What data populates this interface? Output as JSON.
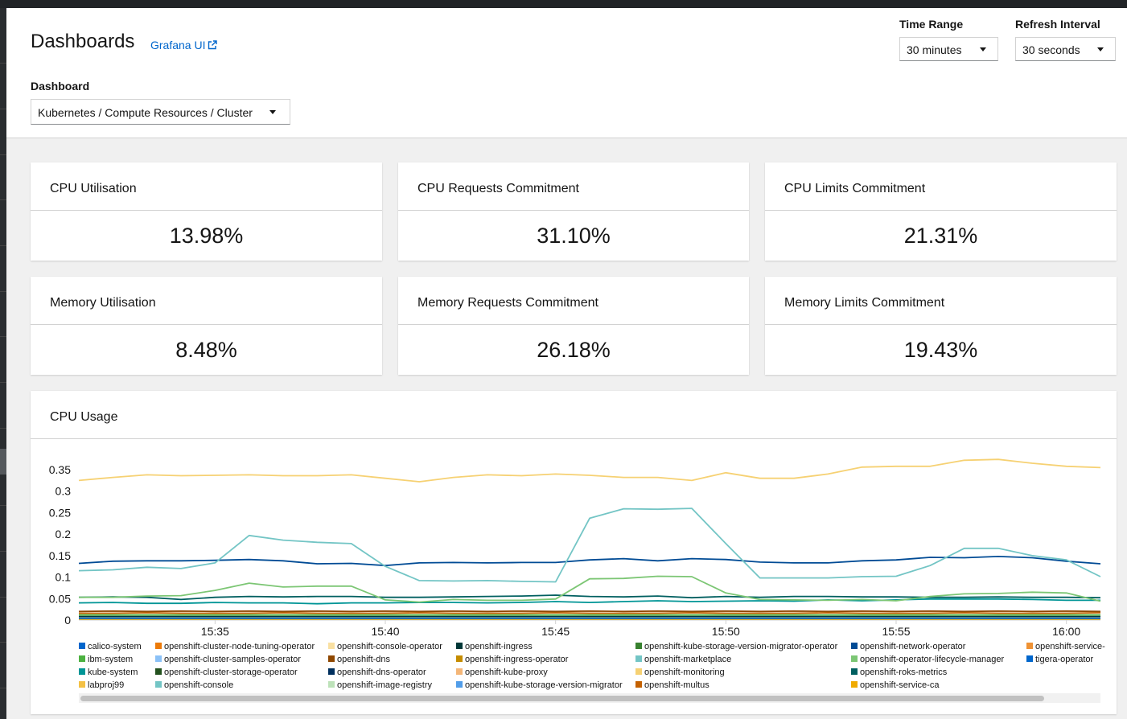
{
  "header": {
    "title": "Dashboards",
    "grafana_link": "Grafana UI",
    "time_range": {
      "label": "Time Range",
      "value": "30 minutes"
    },
    "refresh_interval": {
      "label": "Refresh Interval",
      "value": "30 seconds"
    },
    "dashboard": {
      "label": "Dashboard",
      "value": "Kubernetes / Compute Resources / Cluster"
    }
  },
  "stats": [
    {
      "title": "CPU Utilisation",
      "value": "13.98%"
    },
    {
      "title": "CPU Requests Commitment",
      "value": "31.10%"
    },
    {
      "title": "CPU Limits Commitment",
      "value": "21.31%"
    },
    {
      "title": "Memory Utilisation",
      "value": "8.48%"
    },
    {
      "title": "Memory Requests Commitment",
      "value": "26.18%"
    },
    {
      "title": "Memory Limits Commitment",
      "value": "19.43%"
    }
  ],
  "cpu_panel": {
    "title": "CPU Usage"
  },
  "legend": [
    {
      "name": "calico-system",
      "color": "#0066cc"
    },
    {
      "name": "ibm-system",
      "color": "#4cb140"
    },
    {
      "name": "kube-system",
      "color": "#009596"
    },
    {
      "name": "labproj99",
      "color": "#f4c145"
    },
    {
      "name": "openshift-cluster-node-tuning-operator",
      "color": "#ec7a08"
    },
    {
      "name": "openshift-cluster-samples-operator",
      "color": "#8bc1f7"
    },
    {
      "name": "openshift-cluster-storage-operator",
      "color": "#23511e"
    },
    {
      "name": "openshift-console",
      "color": "#73c5c5"
    },
    {
      "name": "openshift-console-operator",
      "color": "#f9e0a2"
    },
    {
      "name": "openshift-dns",
      "color": "#8f4700"
    },
    {
      "name": "openshift-dns-operator",
      "color": "#002f5d"
    },
    {
      "name": "openshift-image-registry",
      "color": "#bde2b9"
    },
    {
      "name": "openshift-ingress",
      "color": "#003737"
    },
    {
      "name": "openshift-ingress-operator",
      "color": "#c58c00"
    },
    {
      "name": "openshift-kube-proxy",
      "color": "#f4b678"
    },
    {
      "name": "openshift-kube-storage-version-migrator",
      "color": "#519de9"
    },
    {
      "name": "openshift-kube-storage-version-migrator-operator",
      "color": "#38812f"
    },
    {
      "name": "openshift-marketplace",
      "color": "#73c5c5"
    },
    {
      "name": "openshift-monitoring",
      "color": "#f6d173"
    },
    {
      "name": "openshift-multus",
      "color": "#c46100"
    },
    {
      "name": "openshift-network-operator",
      "color": "#004b95"
    },
    {
      "name": "openshift-operator-lifecycle-manager",
      "color": "#7cc674"
    },
    {
      "name": "openshift-roks-metrics",
      "color": "#005f60"
    },
    {
      "name": "openshift-service-ca",
      "color": "#f0ab00"
    },
    {
      "name": "openshift-service-",
      "color": "#ef9234"
    },
    {
      "name": "tigera-operator",
      "color": "#0066cc"
    }
  ],
  "chart_data": {
    "type": "line",
    "title": "CPU Usage",
    "xlabel": "",
    "ylabel": "",
    "ylim": [
      0,
      0.38
    ],
    "yticks": [
      0,
      0.05,
      0.1,
      0.15,
      0.2,
      0.25,
      0.3,
      0.35
    ],
    "ytick_labels": [
      "0",
      "0.05",
      "0.1",
      "0.15",
      "0.2",
      "0.25",
      "0.3",
      "0.35"
    ],
    "xlim": [
      "15:31",
      "16:01"
    ],
    "xtick_labels": [
      "15:35",
      "15:40",
      "15:45",
      "15:50",
      "15:55",
      "16:00"
    ],
    "grid": false,
    "legend_position": "bottom",
    "x": [
      "15:31",
      "15:32",
      "15:33",
      "15:34",
      "15:35",
      "15:36",
      "15:37",
      "15:38",
      "15:39",
      "15:40",
      "15:41",
      "15:42",
      "15:43",
      "15:44",
      "15:45",
      "15:46",
      "15:47",
      "15:48",
      "15:49",
      "15:50",
      "15:51",
      "15:52",
      "15:53",
      "15:54",
      "15:55",
      "15:56",
      "15:57",
      "15:58",
      "15:59",
      "16:00",
      "16:01"
    ],
    "series": [
      {
        "name": "openshift-monitoring",
        "color": "#f6d173",
        "values": [
          0.325,
          0.332,
          0.338,
          0.336,
          0.337,
          0.338,
          0.336,
          0.336,
          0.338,
          0.33,
          0.322,
          0.332,
          0.338,
          0.336,
          0.34,
          0.337,
          0.332,
          0.332,
          0.325,
          0.343,
          0.33,
          0.33,
          0.34,
          0.356,
          0.358,
          0.358,
          0.372,
          0.374,
          0.365,
          0.358,
          0.355
        ]
      },
      {
        "name": "openshift-marketplace",
        "color": "#73c5c5",
        "values": [
          0.115,
          0.117,
          0.123,
          0.12,
          0.133,
          0.197,
          0.186,
          0.181,
          0.178,
          0.125,
          0.092,
          0.091,
          0.092,
          0.09,
          0.089,
          0.237,
          0.259,
          0.258,
          0.26,
          0.178,
          0.098,
          0.098,
          0.098,
          0.101,
          0.102,
          0.127,
          0.167,
          0.167,
          0.15,
          0.14,
          0.101
        ]
      },
      {
        "name": "openshift-network-operator",
        "color": "#004b95",
        "values": [
          0.132,
          0.137,
          0.138,
          0.138,
          0.139,
          0.141,
          0.138,
          0.131,
          0.132,
          0.127,
          0.133,
          0.134,
          0.133,
          0.134,
          0.134,
          0.14,
          0.143,
          0.138,
          0.143,
          0.141,
          0.135,
          0.133,
          0.133,
          0.138,
          0.14,
          0.146,
          0.145,
          0.148,
          0.145,
          0.137,
          0.131
        ]
      },
      {
        "name": "openshift-operator-lifecycle-manager",
        "color": "#7cc674",
        "values": [
          0.053,
          0.053,
          0.056,
          0.057,
          0.069,
          0.086,
          0.077,
          0.079,
          0.079,
          0.047,
          0.042,
          0.048,
          0.046,
          0.046,
          0.049,
          0.096,
          0.097,
          0.102,
          0.101,
          0.063,
          0.048,
          0.047,
          0.046,
          0.048,
          0.045,
          0.055,
          0.061,
          0.062,
          0.065,
          0.063,
          0.044
        ]
      },
      {
        "name": "openshift-roks-metrics",
        "color": "#005f60",
        "values": [
          0.053,
          0.054,
          0.053,
          0.048,
          0.053,
          0.055,
          0.054,
          0.055,
          0.055,
          0.053,
          0.053,
          0.054,
          0.055,
          0.056,
          0.058,
          0.055,
          0.054,
          0.056,
          0.052,
          0.055,
          0.053,
          0.055,
          0.055,
          0.054,
          0.054,
          0.053,
          0.053,
          0.054,
          0.053,
          0.053,
          0.052
        ]
      },
      {
        "name": "kube-system",
        "color": "#009596",
        "values": [
          0.04,
          0.041,
          0.039,
          0.039,
          0.041,
          0.04,
          0.04,
          0.038,
          0.04,
          0.04,
          0.041,
          0.041,
          0.04,
          0.041,
          0.043,
          0.041,
          0.043,
          0.045,
          0.043,
          0.044,
          0.045,
          0.044,
          0.047,
          0.045,
          0.047,
          0.049,
          0.049,
          0.049,
          0.048,
          0.046,
          0.046
        ]
      },
      {
        "name": "openshift-dns",
        "color": "#8f4700",
        "values": [
          0.02,
          0.021,
          0.02,
          0.021,
          0.02,
          0.021,
          0.02,
          0.021,
          0.02,
          0.021,
          0.02,
          0.021,
          0.02,
          0.021,
          0.02,
          0.021,
          0.02,
          0.021,
          0.02,
          0.021,
          0.02,
          0.021,
          0.02,
          0.021,
          0.02,
          0.021,
          0.02,
          0.021,
          0.02,
          0.021,
          0.02
        ]
      },
      {
        "name": "openshift-multus",
        "color": "#c46100",
        "values": [
          0.016,
          0.016,
          0.017,
          0.016,
          0.016,
          0.016,
          0.017,
          0.016,
          0.016,
          0.016,
          0.017,
          0.016,
          0.016,
          0.016,
          0.017,
          0.016,
          0.016,
          0.016,
          0.017,
          0.016,
          0.016,
          0.016,
          0.017,
          0.016,
          0.016,
          0.016,
          0.017,
          0.016,
          0.016,
          0.016,
          0.017
        ]
      },
      {
        "name": "ibm-system",
        "color": "#4cb140",
        "values": [
          0.012,
          0.012,
          0.012,
          0.012,
          0.012,
          0.012,
          0.012,
          0.012,
          0.012,
          0.012,
          0.012,
          0.012,
          0.012,
          0.012,
          0.012,
          0.012,
          0.012,
          0.012,
          0.012,
          0.012,
          0.012,
          0.012,
          0.012,
          0.012,
          0.012,
          0.012,
          0.012,
          0.012,
          0.012,
          0.012,
          0.012
        ]
      },
      {
        "name": "openshift-ingress",
        "color": "#003737",
        "values": [
          0.008,
          0.008,
          0.008,
          0.008,
          0.008,
          0.008,
          0.008,
          0.008,
          0.008,
          0.008,
          0.008,
          0.008,
          0.008,
          0.008,
          0.008,
          0.008,
          0.008,
          0.008,
          0.008,
          0.008,
          0.008,
          0.008,
          0.008,
          0.008,
          0.008,
          0.008,
          0.008,
          0.008,
          0.008,
          0.008,
          0.008
        ]
      },
      {
        "name": "calico-system",
        "color": "#0066cc",
        "values": [
          0.004,
          0.004,
          0.004,
          0.004,
          0.004,
          0.004,
          0.004,
          0.004,
          0.004,
          0.004,
          0.004,
          0.004,
          0.004,
          0.004,
          0.004,
          0.004,
          0.004,
          0.004,
          0.004,
          0.004,
          0.004,
          0.004,
          0.004,
          0.004,
          0.004,
          0.004,
          0.004,
          0.004,
          0.004,
          0.004,
          0.004
        ]
      },
      {
        "name": "openshift-service-ca",
        "color": "#f0ab00",
        "values": [
          0.002,
          0.002,
          0.002,
          0.002,
          0.002,
          0.002,
          0.002,
          0.002,
          0.002,
          0.002,
          0.002,
          0.002,
          0.002,
          0.002,
          0.002,
          0.002,
          0.002,
          0.002,
          0.002,
          0.002,
          0.002,
          0.002,
          0.002,
          0.002,
          0.002,
          0.002,
          0.002,
          0.002,
          0.002,
          0.002,
          0.002
        ]
      }
    ]
  }
}
